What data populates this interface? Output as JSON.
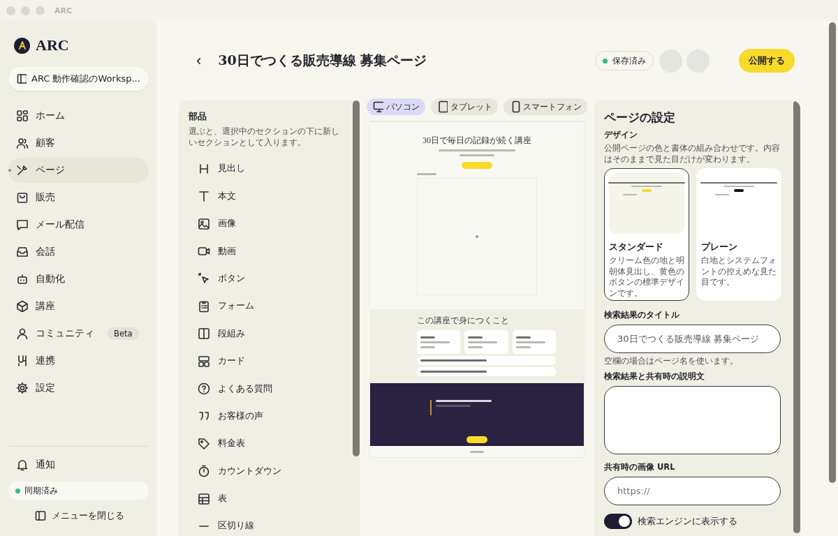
{
  "window": {
    "title": "ARC"
  },
  "sidebar": {
    "logo": "ARC",
    "workspace": "ARC 動作確認のWorksp...",
    "items": [
      {
        "label": "ホーム",
        "selected": false
      },
      {
        "label": "顧客",
        "selected": false
      },
      {
        "label": "ページ",
        "selected": true
      },
      {
        "label": "販売",
        "selected": false
      },
      {
        "label": "メール配信",
        "selected": false
      },
      {
        "label": "会話",
        "selected": false
      },
      {
        "label": "自動化",
        "selected": false
      },
      {
        "label": "講座",
        "selected": false
      },
      {
        "label": "コミュニティ",
        "selected": false,
        "badge": "Beta"
      },
      {
        "label": "連携",
        "selected": false
      },
      {
        "label": "設定",
        "selected": false
      }
    ],
    "notifications": "通知",
    "sync_status": "同期済み",
    "collapse": "メニューを閉じる"
  },
  "header": {
    "back": "‹",
    "title": "30日でつくる販売導線 募集ページ",
    "save_status": "保存済み",
    "publish": "公開する"
  },
  "parts": {
    "title": "部品",
    "description": "選ぶと、選択中のセクションの下に新しいセクションとして入ります。",
    "items": [
      "見出し",
      "本文",
      "画像",
      "動画",
      "ボタン",
      "フォーム",
      "段組み",
      "カード",
      "よくある質問",
      "お客様の声",
      "料金表",
      "カウントダウン",
      "表",
      "区切り線"
    ]
  },
  "preview": {
    "devices": [
      {
        "label": "パソコン",
        "selected": true
      },
      {
        "label": "タブレット",
        "selected": false
      },
      {
        "label": "スマートフォン",
        "selected": false
      }
    ],
    "page_title": "30日で毎日の記録が続く講座",
    "section_title": "この講座で身につくこと"
  },
  "settings": {
    "title": "ページの設定",
    "design_label": "デザイン",
    "design_help": "公開ページの色と書体の組み合わせです。内容はそのままで見た目だけが変わります。",
    "designs": [
      {
        "name": "スタンダード",
        "description": "クリーム色の地と明朝体見出し、黄色のボタンの標準デザインです。",
        "selected": true,
        "kind": "standard"
      },
      {
        "name": "プレーン",
        "description": "白地とシステムフォントの控えめな見た目です。",
        "selected": false,
        "kind": "plain"
      }
    ],
    "seo_title_label": "検索結果のタイトル",
    "seo_title_value": "30日でつくる販売導線 募集ページ",
    "seo_title_help": "空欄の場合はページ名を使います。",
    "description_label": "検索結果と共有時の説明文",
    "image_label": "共有時の画像 URL",
    "image_placeholder": "https://",
    "search_toggle": {
      "label": "検索エンジンに表示する",
      "on": true
    }
  }
}
